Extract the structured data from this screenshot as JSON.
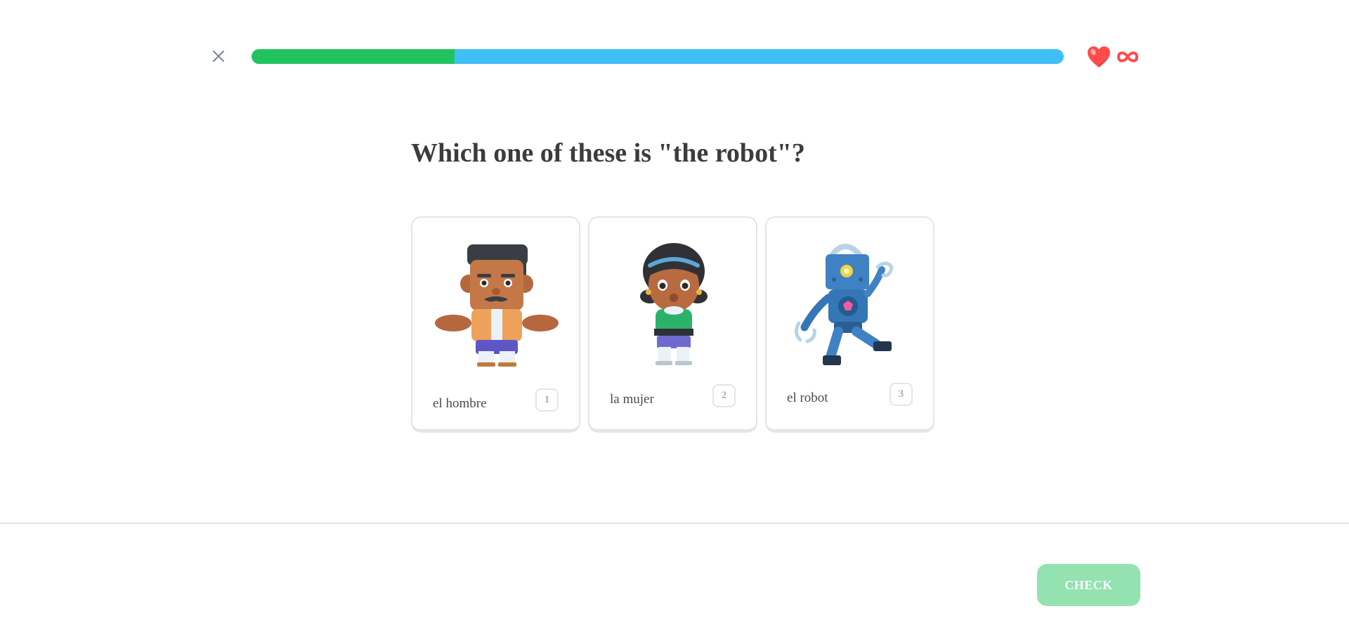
{
  "progress": {
    "fraction": 0.25
  },
  "lives": {
    "value": "infinite",
    "heart_color": "#ff4b4b",
    "infinity_color": "#ff4b4b"
  },
  "question": {
    "text": "Which one of these is \"the robot\"?"
  },
  "choices": [
    {
      "label": "el hombre",
      "key": "1",
      "illustration": "man-character"
    },
    {
      "label": "la mujer",
      "key": "2",
      "illustration": "woman-character"
    },
    {
      "label": "el robot",
      "key": "3",
      "illustration": "robot-character"
    }
  ],
  "footer": {
    "check_label": "CHECK",
    "check_color": "#93e2b0"
  },
  "colors": {
    "progress_done": "#22c35e",
    "progress_track": "#3fbff5",
    "text": "#3c3c3c"
  }
}
